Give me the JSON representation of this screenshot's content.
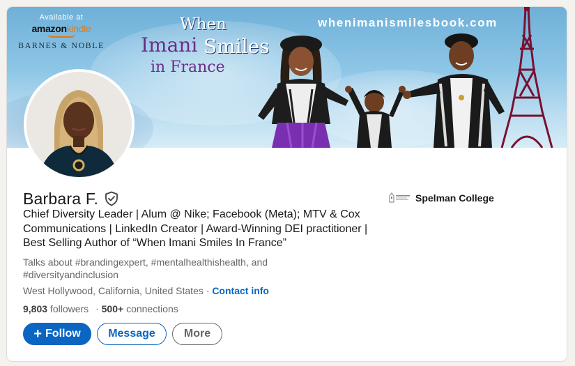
{
  "banner": {
    "available_at": "Available at",
    "amazon": "amazon",
    "kindle": "kindle",
    "barnes_noble": "BARNES & NOBLE",
    "book_title": {
      "line1": "When",
      "line2": "Imani",
      "line3": "Smiles",
      "line4": "in France"
    },
    "website": "whenimanismilesbook.com"
  },
  "profile": {
    "name": "Barbara F.",
    "verified_icon": "shield-check-icon",
    "headline": "Chief Diversity Leader | Alum @ Nike; Facebook (Meta); MTV & Cox Communications | LinkedIn Creator | Award-Winning DEI practitioner | Best Selling Author of “When Imani Smiles In France”",
    "talks_about": "Talks about #brandingexpert, #mentalhealthishealth, and #diversityandinclusion",
    "location": "West Hollywood, California, United States",
    "separator": " · ",
    "contact_info": "Contact info",
    "followers_count": "9,803",
    "followers_label": " followers",
    "connections_prefix": "·",
    "connections_count": "500+",
    "connections_label": " connections"
  },
  "organization": {
    "name": "Spelman College",
    "logo_icon": "spelman-college-logo"
  },
  "actions": {
    "follow_icon": "plus-icon",
    "follow_label": "Follow",
    "message_label": "Message",
    "more_label": "More"
  },
  "colors": {
    "primary_blue": "#0a66c2",
    "text_secondary": "#666666",
    "page_background": "#f3f2ef"
  }
}
